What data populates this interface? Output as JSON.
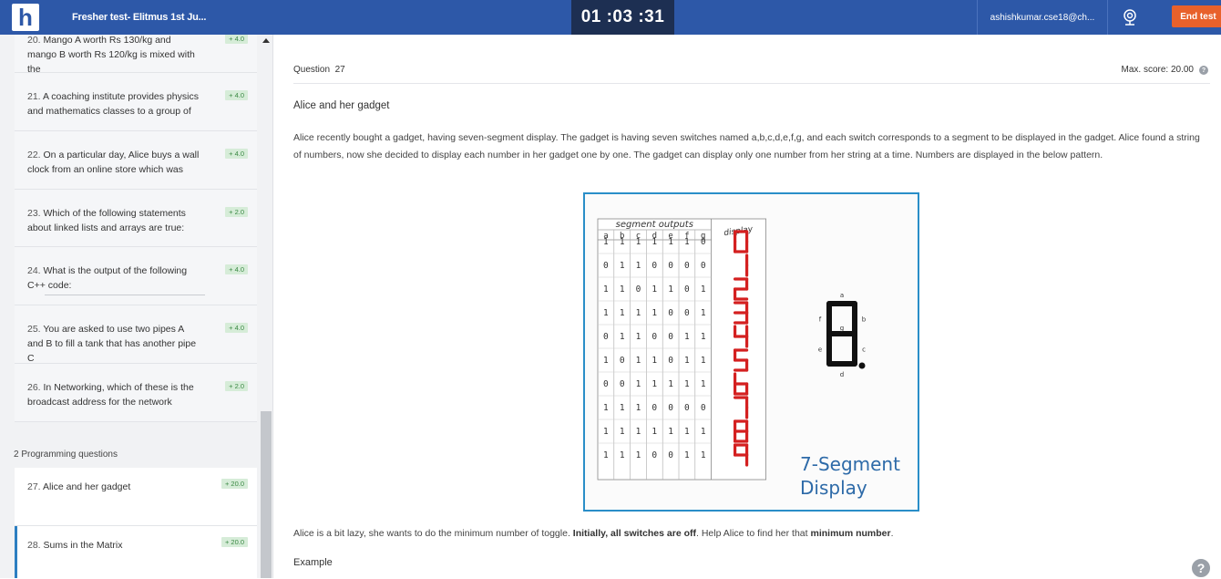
{
  "header": {
    "logo_letter": "h",
    "test_title": "Fresher test- Elitmus 1st Ju...",
    "timer": "01 :03 :31",
    "email": "ashishkumar.cse18@ch...",
    "end_test_label": "End test"
  },
  "sidebar": {
    "questions": [
      {
        "num": "20.",
        "text": "Mango A worth Rs 130/kg and mango B worth Rs 120/kg is mixed with the",
        "score": "+ 4.0"
      },
      {
        "num": "21.",
        "text": "A coaching institute provides physics and mathematics classes to a group of",
        "score": "+ 4.0"
      },
      {
        "num": "22.",
        "text": "On a particular day, Alice buys a wall clock from an online store which was",
        "score": "+ 4.0"
      },
      {
        "num": "23.",
        "text": "Which of the following statements about linked lists and arrays are true:",
        "score": "+ 2.0"
      },
      {
        "num": "24.",
        "text": "What is the output of the following C++ code:",
        "score": "+ 4.0"
      },
      {
        "num": "25.",
        "text": "You are asked to use two pipes A and B to fill a tank that has another pipe C",
        "score": "+ 4.0"
      },
      {
        "num": "26.",
        "text": "In Networking, which of these is the broadcast address for the network",
        "score": "+ 2.0"
      }
    ],
    "section_label": "2 Programming questions",
    "programming": [
      {
        "num": "27.",
        "text": "Alice and her gadget",
        "score": "+ 20.0"
      },
      {
        "num": "28.",
        "text": "Sums in the Matrix",
        "score": "+ 20.0"
      }
    ]
  },
  "main": {
    "question_label": "Question",
    "question_number": "27",
    "max_score_label": "Max. score: 20.00",
    "title": "Alice and her gadget",
    "paragraph": "Alice recently bought a gadget, having seven-segment display. The gadget is having seven switches named a,b,c,d,e,f,g, and each switch corresponds to a segment to be displayed in the gadget. Alice found a string of numbers, now she decided to display each number in her gadget one by one. The gadget can display only one number from her string at a time. Numbers are displayed in the below pattern.",
    "paragraph2_a": "Alice is a bit lazy, she wants to do the minimum number of toggle. ",
    "paragraph2_b": "Initially, all switches are off",
    "paragraph2_c": ". Help Alice to find her that ",
    "paragraph2_d": "minimum number",
    "paragraph2_e": ".",
    "example_label": "Example"
  },
  "figure": {
    "table_heading": "segment outputs",
    "display_heading": "display",
    "columns": [
      "a",
      "b",
      "c",
      "d",
      "e",
      "f",
      "g"
    ],
    "rows": [
      [
        1,
        1,
        1,
        1,
        1,
        1,
        0
      ],
      [
        0,
        1,
        1,
        0,
        0,
        0,
        0
      ],
      [
        1,
        1,
        0,
        1,
        1,
        0,
        1
      ],
      [
        1,
        1,
        1,
        1,
        0,
        0,
        1
      ],
      [
        0,
        1,
        1,
        0,
        0,
        1,
        1
      ],
      [
        1,
        0,
        1,
        1,
        0,
        1,
        1
      ],
      [
        0,
        0,
        1,
        1,
        1,
        1,
        1
      ],
      [
        1,
        1,
        1,
        0,
        0,
        0,
        0
      ],
      [
        1,
        1,
        1,
        1,
        1,
        1,
        1
      ],
      [
        1,
        1,
        1,
        0,
        0,
        1,
        1
      ]
    ],
    "digits": [
      "0",
      "1",
      "2",
      "3",
      "4",
      "5",
      "6",
      "7",
      "8",
      "9"
    ],
    "segment_letters": [
      "a",
      "b",
      "c",
      "d",
      "e",
      "f",
      "g"
    ],
    "caption_line1": "7-Segment",
    "caption_line2": "Display",
    "digit_color": "#d42020",
    "caption_color": "#2d6aa8"
  },
  "colors": {
    "header_bg": "#2d58a8",
    "timer_bg": "#1d2f52",
    "end_button": "#e8612b",
    "badge_bg": "#d6ecd8",
    "active_border": "#2d7fc1"
  }
}
